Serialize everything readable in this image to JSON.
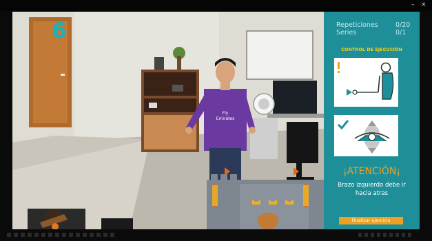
{
  "session": {
    "exercise_counter": "6",
    "repetitions_label": "Repeticiones",
    "repetitions_value": "0/20",
    "series_label": "Series",
    "series_value": "0/1"
  },
  "control": {
    "title": "CONTROL DE EJECUCIÓN",
    "alert_title": "¡ATENCIÓN¡",
    "alert_message": "Brazo izquierdo debe ir hacia atras",
    "finish_label": "Finalizar ejercicio"
  },
  "icons": {
    "warning": "exclamation-icon",
    "ok": "checkmark-icon"
  },
  "colors": {
    "panel": "#1e8f99",
    "accent": "#f0a020",
    "title_yellow": "#f2d21b",
    "counter": "#1bb0bf"
  },
  "shirt": {
    "line1": "Fly",
    "line2": "Emirates"
  }
}
